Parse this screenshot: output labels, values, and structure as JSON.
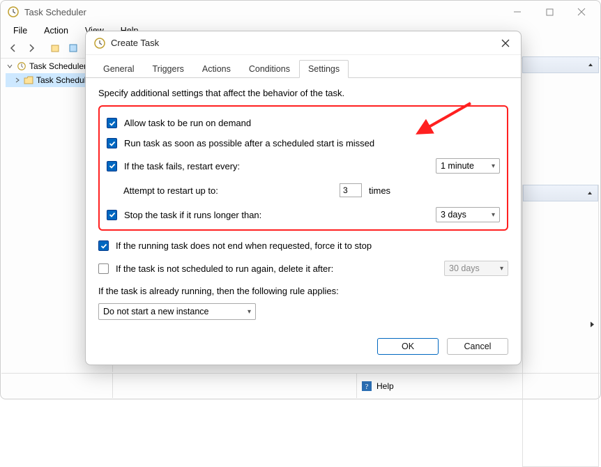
{
  "window": {
    "title": "Task Scheduler"
  },
  "menu": [
    "File",
    "Action",
    "View",
    "Help"
  ],
  "tree": {
    "root": "Task Scheduler (L",
    "child": "Task Schedule"
  },
  "help_label": "Help",
  "dialog": {
    "title": "Create Task",
    "tabs": [
      "General",
      "Triggers",
      "Actions",
      "Conditions",
      "Settings"
    ],
    "active_tab": "Settings",
    "description": "Specify additional settings that affect the behavior of the task.",
    "allow_on_demand": "Allow task to be run on demand",
    "run_asap": "Run task as soon as possible after a scheduled start is missed",
    "if_fails_label": "If the task fails, restart every:",
    "restart_every_value": "1 minute",
    "attempt_label": "Attempt to restart up to:",
    "attempt_value": "3",
    "attempt_suffix": "times",
    "stop_longer_label": "Stop the task if it runs longer than:",
    "stop_longer_value": "3 days",
    "force_stop_label": "If the running task does not end when requested, force it to stop",
    "delete_after_label": "If the task is not scheduled to run again, delete it after:",
    "delete_after_value": "30 days",
    "rule_label": "If the task is already running, then the following rule applies:",
    "rule_value": "Do not start a new instance",
    "ok": "OK",
    "cancel": "Cancel"
  }
}
